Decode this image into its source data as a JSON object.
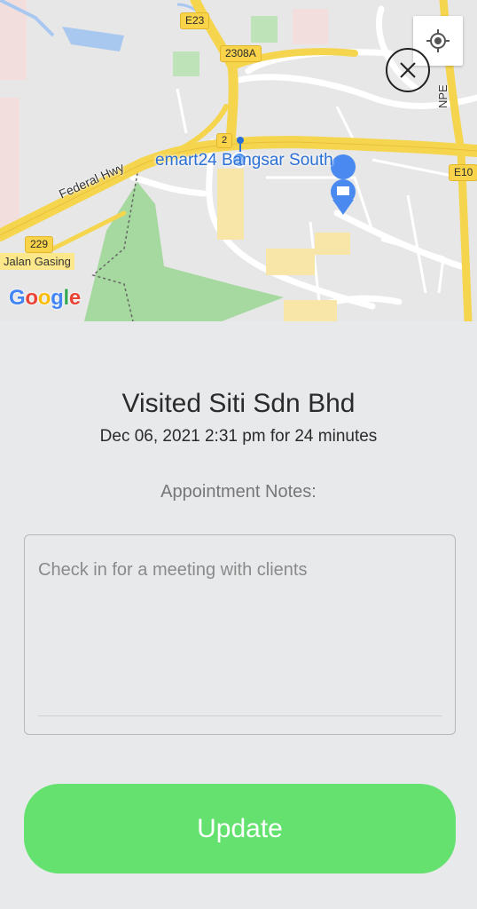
{
  "map": {
    "shields": {
      "e23": "E23",
      "h2308a": "2308A",
      "r2": "2",
      "e10": "E10",
      "r229": "229"
    },
    "roads": {
      "federal_hwy": "Federal Hwy",
      "npe": "NPE"
    },
    "places": {
      "jalan_gasing": "Jalan Gasing"
    },
    "poi_label": "emart24 Bangsar South",
    "attribution": {
      "letters": [
        "G",
        "o",
        "o",
        "g",
        "l",
        "e"
      ],
      "colors": [
        "#4285F4",
        "#EA4335",
        "#FBBC05",
        "#4285F4",
        "#34A853",
        "#EA4335"
      ]
    }
  },
  "visit": {
    "title": "Visited Siti Sdn Bhd",
    "details": "Dec 06, 2021 2:31 pm for 24 minutes"
  },
  "notes": {
    "label": "Appointment Notes:",
    "value": "Check in for a meeting with clients"
  },
  "actions": {
    "update_label": "Update"
  },
  "colors": {
    "accent_green": "#64e16f",
    "background": "#e8e9eb",
    "map_highway": "#f6d54e",
    "map_park": "#9fd69a",
    "poi_blue": "#2a6fd6"
  }
}
